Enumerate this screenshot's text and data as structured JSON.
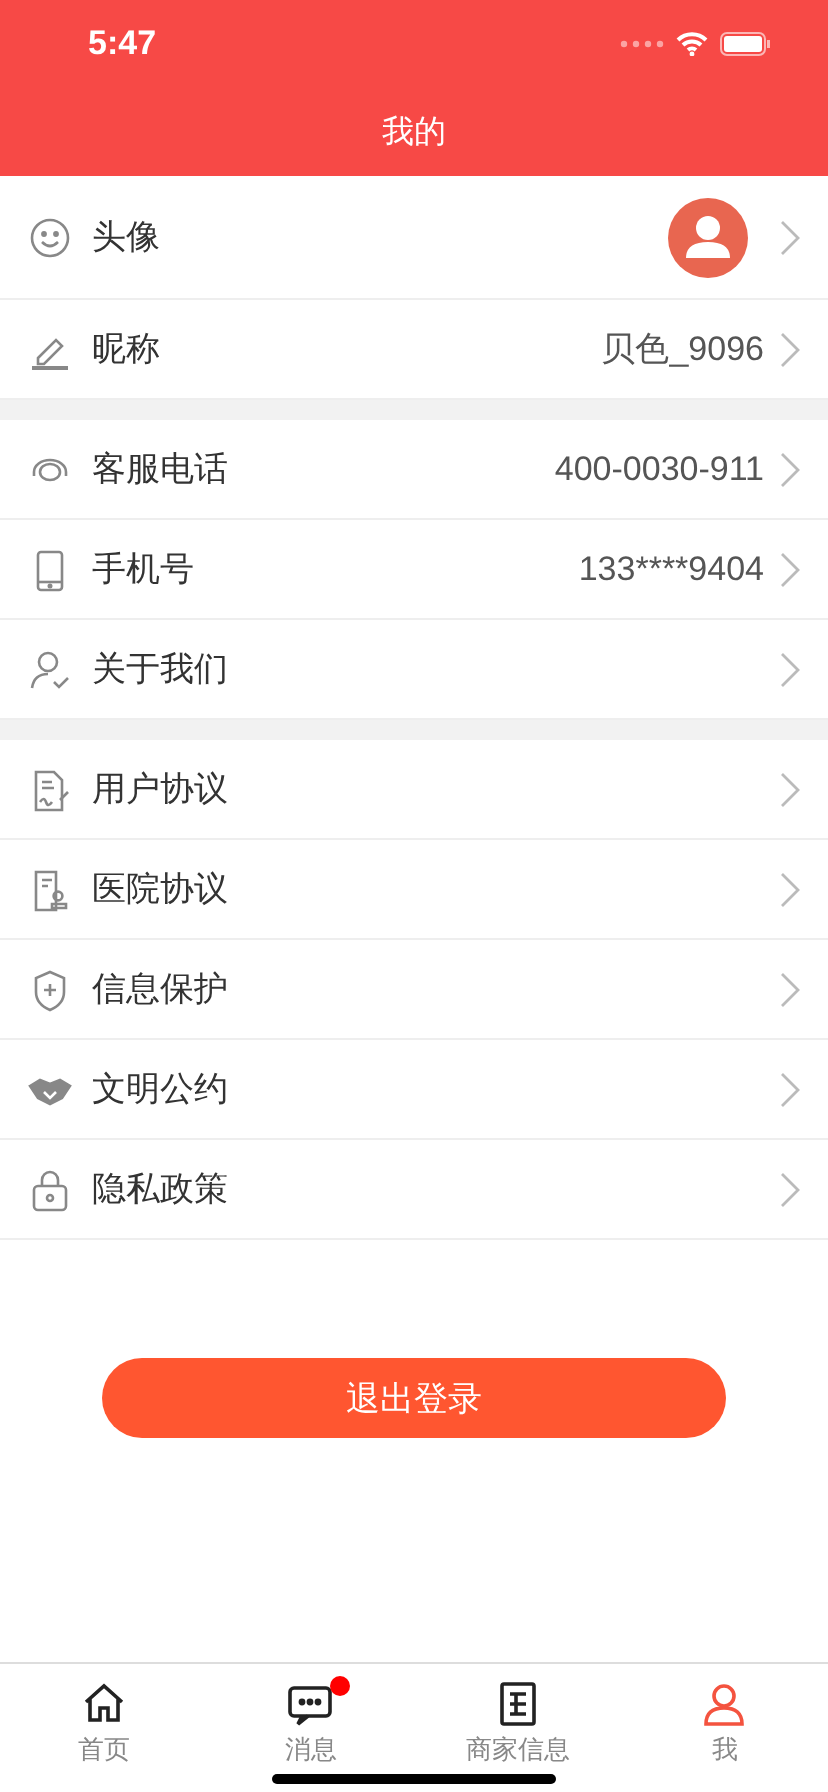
{
  "status_bar": {
    "time": "5:47"
  },
  "nav_bar": {
    "title": "我的"
  },
  "sections": [
    {
      "rows": [
        {
          "kind": "avatar",
          "label": "头像"
        },
        {
          "kind": "value",
          "label": "昵称",
          "value": "贝色_9096"
        }
      ]
    },
    {
      "rows": [
        {
          "kind": "value",
          "label": "客服电话",
          "value": "400-0030-911"
        },
        {
          "kind": "value",
          "label": "手机号",
          "value": "133****9404"
        },
        {
          "kind": "link",
          "label": "关于我们"
        }
      ]
    },
    {
      "rows": [
        {
          "kind": "link",
          "label": "用户协议"
        },
        {
          "kind": "link",
          "label": "医院协议"
        },
        {
          "kind": "link",
          "label": "信息保护"
        },
        {
          "kind": "link",
          "label": "文明公约"
        },
        {
          "kind": "link",
          "label": "隐私政策"
        }
      ]
    }
  ],
  "logout_button": "退出登录",
  "tab_bar": [
    {
      "label": "首页",
      "selected": false,
      "badge": false
    },
    {
      "label": "消息",
      "selected": false,
      "badge": true
    },
    {
      "label": "商家信息",
      "selected": false,
      "badge": false
    },
    {
      "label": "我",
      "selected": true,
      "badge": false
    }
  ]
}
